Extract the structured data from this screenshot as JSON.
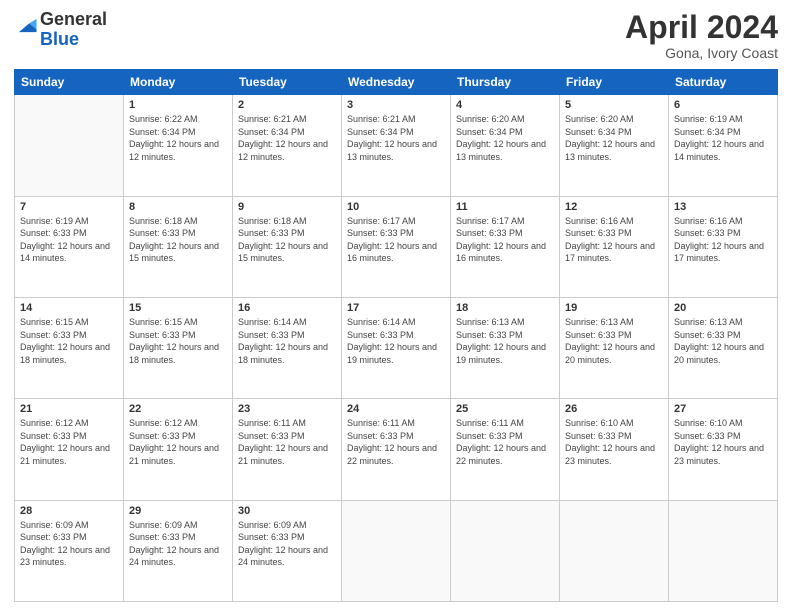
{
  "logo": {
    "part1": "General",
    "part2": "Blue"
  },
  "header": {
    "title": "April 2024",
    "subtitle": "Gona, Ivory Coast"
  },
  "weekdays": [
    "Sunday",
    "Monday",
    "Tuesday",
    "Wednesday",
    "Thursday",
    "Friday",
    "Saturday"
  ],
  "weeks": [
    [
      {
        "day": "",
        "sunrise": "",
        "sunset": "",
        "daylight": ""
      },
      {
        "day": "1",
        "sunrise": "Sunrise: 6:22 AM",
        "sunset": "Sunset: 6:34 PM",
        "daylight": "Daylight: 12 hours and 12 minutes."
      },
      {
        "day": "2",
        "sunrise": "Sunrise: 6:21 AM",
        "sunset": "Sunset: 6:34 PM",
        "daylight": "Daylight: 12 hours and 12 minutes."
      },
      {
        "day": "3",
        "sunrise": "Sunrise: 6:21 AM",
        "sunset": "Sunset: 6:34 PM",
        "daylight": "Daylight: 12 hours and 13 minutes."
      },
      {
        "day": "4",
        "sunrise": "Sunrise: 6:20 AM",
        "sunset": "Sunset: 6:34 PM",
        "daylight": "Daylight: 12 hours and 13 minutes."
      },
      {
        "day": "5",
        "sunrise": "Sunrise: 6:20 AM",
        "sunset": "Sunset: 6:34 PM",
        "daylight": "Daylight: 12 hours and 13 minutes."
      },
      {
        "day": "6",
        "sunrise": "Sunrise: 6:19 AM",
        "sunset": "Sunset: 6:34 PM",
        "daylight": "Daylight: 12 hours and 14 minutes."
      }
    ],
    [
      {
        "day": "7",
        "sunrise": "Sunrise: 6:19 AM",
        "sunset": "Sunset: 6:33 PM",
        "daylight": "Daylight: 12 hours and 14 minutes."
      },
      {
        "day": "8",
        "sunrise": "Sunrise: 6:18 AM",
        "sunset": "Sunset: 6:33 PM",
        "daylight": "Daylight: 12 hours and 15 minutes."
      },
      {
        "day": "9",
        "sunrise": "Sunrise: 6:18 AM",
        "sunset": "Sunset: 6:33 PM",
        "daylight": "Daylight: 12 hours and 15 minutes."
      },
      {
        "day": "10",
        "sunrise": "Sunrise: 6:17 AM",
        "sunset": "Sunset: 6:33 PM",
        "daylight": "Daylight: 12 hours and 16 minutes."
      },
      {
        "day": "11",
        "sunrise": "Sunrise: 6:17 AM",
        "sunset": "Sunset: 6:33 PM",
        "daylight": "Daylight: 12 hours and 16 minutes."
      },
      {
        "day": "12",
        "sunrise": "Sunrise: 6:16 AM",
        "sunset": "Sunset: 6:33 PM",
        "daylight": "Daylight: 12 hours and 17 minutes."
      },
      {
        "day": "13",
        "sunrise": "Sunrise: 6:16 AM",
        "sunset": "Sunset: 6:33 PM",
        "daylight": "Daylight: 12 hours and 17 minutes."
      }
    ],
    [
      {
        "day": "14",
        "sunrise": "Sunrise: 6:15 AM",
        "sunset": "Sunset: 6:33 PM",
        "daylight": "Daylight: 12 hours and 18 minutes."
      },
      {
        "day": "15",
        "sunrise": "Sunrise: 6:15 AM",
        "sunset": "Sunset: 6:33 PM",
        "daylight": "Daylight: 12 hours and 18 minutes."
      },
      {
        "day": "16",
        "sunrise": "Sunrise: 6:14 AM",
        "sunset": "Sunset: 6:33 PM",
        "daylight": "Daylight: 12 hours and 18 minutes."
      },
      {
        "day": "17",
        "sunrise": "Sunrise: 6:14 AM",
        "sunset": "Sunset: 6:33 PM",
        "daylight": "Daylight: 12 hours and 19 minutes."
      },
      {
        "day": "18",
        "sunrise": "Sunrise: 6:13 AM",
        "sunset": "Sunset: 6:33 PM",
        "daylight": "Daylight: 12 hours and 19 minutes."
      },
      {
        "day": "19",
        "sunrise": "Sunrise: 6:13 AM",
        "sunset": "Sunset: 6:33 PM",
        "daylight": "Daylight: 12 hours and 20 minutes."
      },
      {
        "day": "20",
        "sunrise": "Sunrise: 6:13 AM",
        "sunset": "Sunset: 6:33 PM",
        "daylight": "Daylight: 12 hours and 20 minutes."
      }
    ],
    [
      {
        "day": "21",
        "sunrise": "Sunrise: 6:12 AM",
        "sunset": "Sunset: 6:33 PM",
        "daylight": "Daylight: 12 hours and 21 minutes."
      },
      {
        "day": "22",
        "sunrise": "Sunrise: 6:12 AM",
        "sunset": "Sunset: 6:33 PM",
        "daylight": "Daylight: 12 hours and 21 minutes."
      },
      {
        "day": "23",
        "sunrise": "Sunrise: 6:11 AM",
        "sunset": "Sunset: 6:33 PM",
        "daylight": "Daylight: 12 hours and 21 minutes."
      },
      {
        "day": "24",
        "sunrise": "Sunrise: 6:11 AM",
        "sunset": "Sunset: 6:33 PM",
        "daylight": "Daylight: 12 hours and 22 minutes."
      },
      {
        "day": "25",
        "sunrise": "Sunrise: 6:11 AM",
        "sunset": "Sunset: 6:33 PM",
        "daylight": "Daylight: 12 hours and 22 minutes."
      },
      {
        "day": "26",
        "sunrise": "Sunrise: 6:10 AM",
        "sunset": "Sunset: 6:33 PM",
        "daylight": "Daylight: 12 hours and 23 minutes."
      },
      {
        "day": "27",
        "sunrise": "Sunrise: 6:10 AM",
        "sunset": "Sunset: 6:33 PM",
        "daylight": "Daylight: 12 hours and 23 minutes."
      }
    ],
    [
      {
        "day": "28",
        "sunrise": "Sunrise: 6:09 AM",
        "sunset": "Sunset: 6:33 PM",
        "daylight": "Daylight: 12 hours and 23 minutes."
      },
      {
        "day": "29",
        "sunrise": "Sunrise: 6:09 AM",
        "sunset": "Sunset: 6:33 PM",
        "daylight": "Daylight: 12 hours and 24 minutes."
      },
      {
        "day": "30",
        "sunrise": "Sunrise: 6:09 AM",
        "sunset": "Sunset: 6:33 PM",
        "daylight": "Daylight: 12 hours and 24 minutes."
      },
      {
        "day": "",
        "sunrise": "",
        "sunset": "",
        "daylight": ""
      },
      {
        "day": "",
        "sunrise": "",
        "sunset": "",
        "daylight": ""
      },
      {
        "day": "",
        "sunrise": "",
        "sunset": "",
        "daylight": ""
      },
      {
        "day": "",
        "sunrise": "",
        "sunset": "",
        "daylight": ""
      }
    ]
  ]
}
